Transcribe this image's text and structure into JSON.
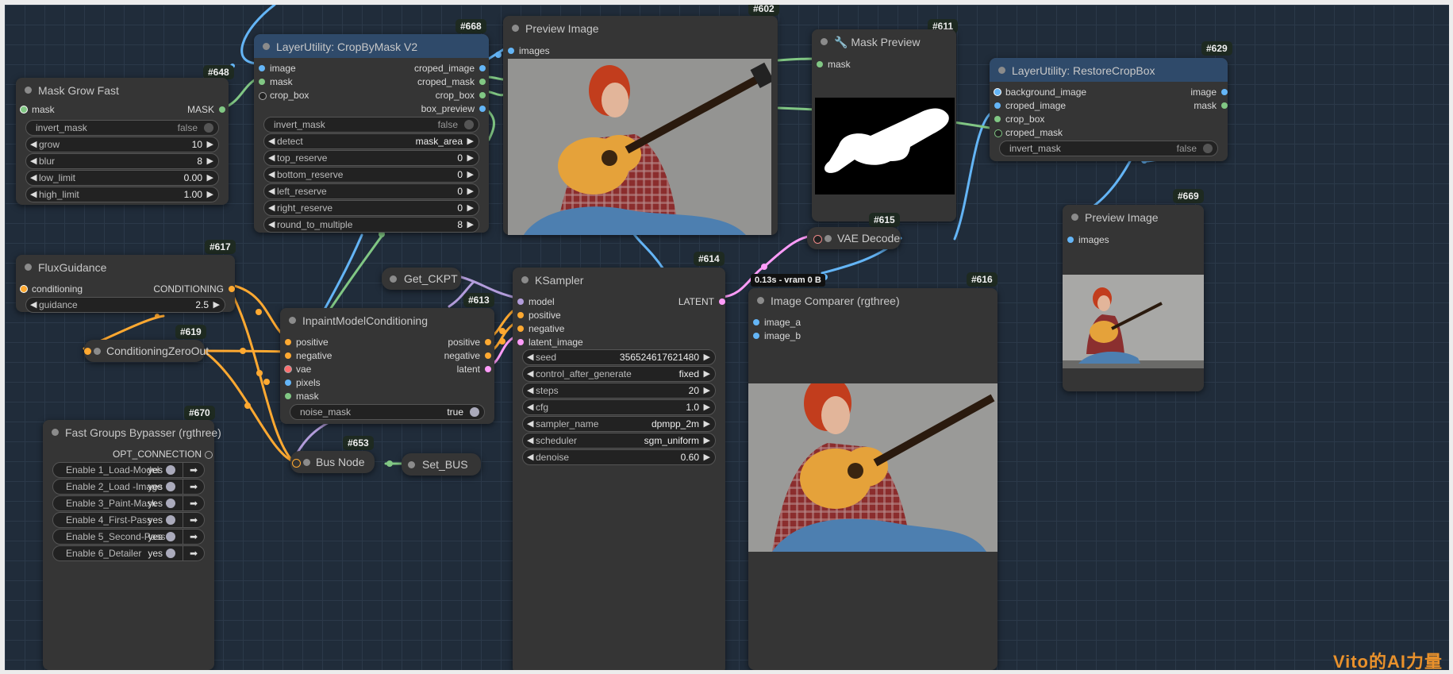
{
  "nodes": {
    "mask_grow": {
      "title": "Mask Grow Fast",
      "badge": "#648",
      "in_mask": "mask",
      "out_mask": "MASK",
      "invert_label": "invert_mask",
      "invert_value": "false",
      "grow_label": "grow",
      "grow_value": "10",
      "blur_label": "blur",
      "blur_value": "8",
      "low_label": "low_limit",
      "low_value": "0.00",
      "high_label": "high_limit",
      "high_value": "1.00"
    },
    "cropbymask": {
      "title": "LayerUtility: CropByMask V2",
      "badge": "#668",
      "in_image": "image",
      "in_mask": "mask",
      "in_crop_box": "crop_box",
      "out_croped_image": "croped_image",
      "out_croped_mask": "croped_mask",
      "out_crop_box": "crop_box",
      "out_box_preview": "box_preview",
      "invert_label": "invert_mask",
      "invert_value": "false",
      "detect_label": "detect",
      "detect_value": "mask_area",
      "top_label": "top_reserve",
      "top_value": "0",
      "bottom_label": "bottom_reserve",
      "bottom_value": "0",
      "left_label": "left_reserve",
      "left_value": "0",
      "right_label": "right_reserve",
      "right_value": "0",
      "round_label": "round_to_multiple",
      "round_value": "8"
    },
    "preview602": {
      "title": "Preview Image",
      "badge": "#602",
      "in_images": "images"
    },
    "maskpreview": {
      "title": "Mask Preview",
      "badge": "#611",
      "in_mask": "mask"
    },
    "restore": {
      "title": "LayerUtility: RestoreCropBox",
      "badge": "#629",
      "in_bg": "background_image",
      "in_croped_image": "croped_image",
      "in_crop_box": "crop_box",
      "in_croped_mask": "croped_mask",
      "out_image": "image",
      "out_mask": "mask",
      "invert_label": "invert_mask",
      "invert_value": "false"
    },
    "preview669": {
      "title": "Preview Image",
      "badge": "#669",
      "in_images": "images"
    },
    "vaedecode": {
      "title": "VAE Decode",
      "badge": "#615",
      "status": "0.13s - vram 0 B"
    },
    "flux": {
      "title": "FluxGuidance",
      "badge": "#617",
      "in_cond": "conditioning",
      "out_cond": "CONDITIONING",
      "guidance_label": "guidance",
      "guidance_value": "2.5"
    },
    "zero": {
      "title": "ConditioningZeroOut",
      "badge": "#619"
    },
    "getckpt": {
      "title": "Get_CKPT"
    },
    "inpaint": {
      "title": "InpaintModelConditioning",
      "badge": "#613",
      "in_positive": "positive",
      "in_negative": "negative",
      "in_vae": "vae",
      "in_pixels": "pixels",
      "in_mask": "mask",
      "out_positive": "positive",
      "out_negative": "negative",
      "out_latent": "latent",
      "noise_label": "noise_mask",
      "noise_value": "true"
    },
    "ksampler": {
      "title": "KSampler",
      "badge": "#614",
      "in_model": "model",
      "in_positive": "positive",
      "in_negative": "negative",
      "in_latent": "latent_image",
      "out_latent": "LATENT",
      "seed_label": "seed",
      "seed_value": "356524617621480",
      "cag_label": "control_after_generate",
      "cag_value": "fixed",
      "steps_label": "steps",
      "steps_value": "20",
      "cfg_label": "cfg",
      "cfg_value": "1.0",
      "sampler_label": "sampler_name",
      "sampler_value": "dpmpp_2m",
      "scheduler_label": "scheduler",
      "scheduler_value": "sgm_uniform",
      "denoise_label": "denoise",
      "denoise_value": "0.60"
    },
    "comparer": {
      "title": "Image Comparer (rgthree)",
      "badge": "#616",
      "in_a": "image_a",
      "in_b": "image_b"
    },
    "bypasser": {
      "title": "Fast Groups Bypasser (rgthree)",
      "badge": "#670",
      "out_opt": "OPT_CONNECTION",
      "items": [
        {
          "label": "Enable 1_Load-Model",
          "value": "yes"
        },
        {
          "label": "Enable 2_Load -Image",
          "value": "yes"
        },
        {
          "label": "Enable 3_Paint-Mask",
          "value": "yes"
        },
        {
          "label": "Enable 4_First-Pass",
          "value": "yes"
        },
        {
          "label": "Enable 5_Second-Pass",
          "value": "yes"
        },
        {
          "label": "Enable 6_Detailer",
          "value": "yes"
        }
      ]
    },
    "busnode": {
      "title": "Bus Node",
      "badge": "#653"
    },
    "setbus": {
      "title": "Set_BUS"
    }
  },
  "watermark": "Vito的AI力量",
  "colors": {
    "image": "#64b5f6",
    "mask": "#81c784",
    "conditioning": "#ffa931",
    "latent": "#ff9cf9",
    "vae": "#ff6e6e",
    "model": "#b39ddb",
    "canvas": "#202c3a"
  }
}
